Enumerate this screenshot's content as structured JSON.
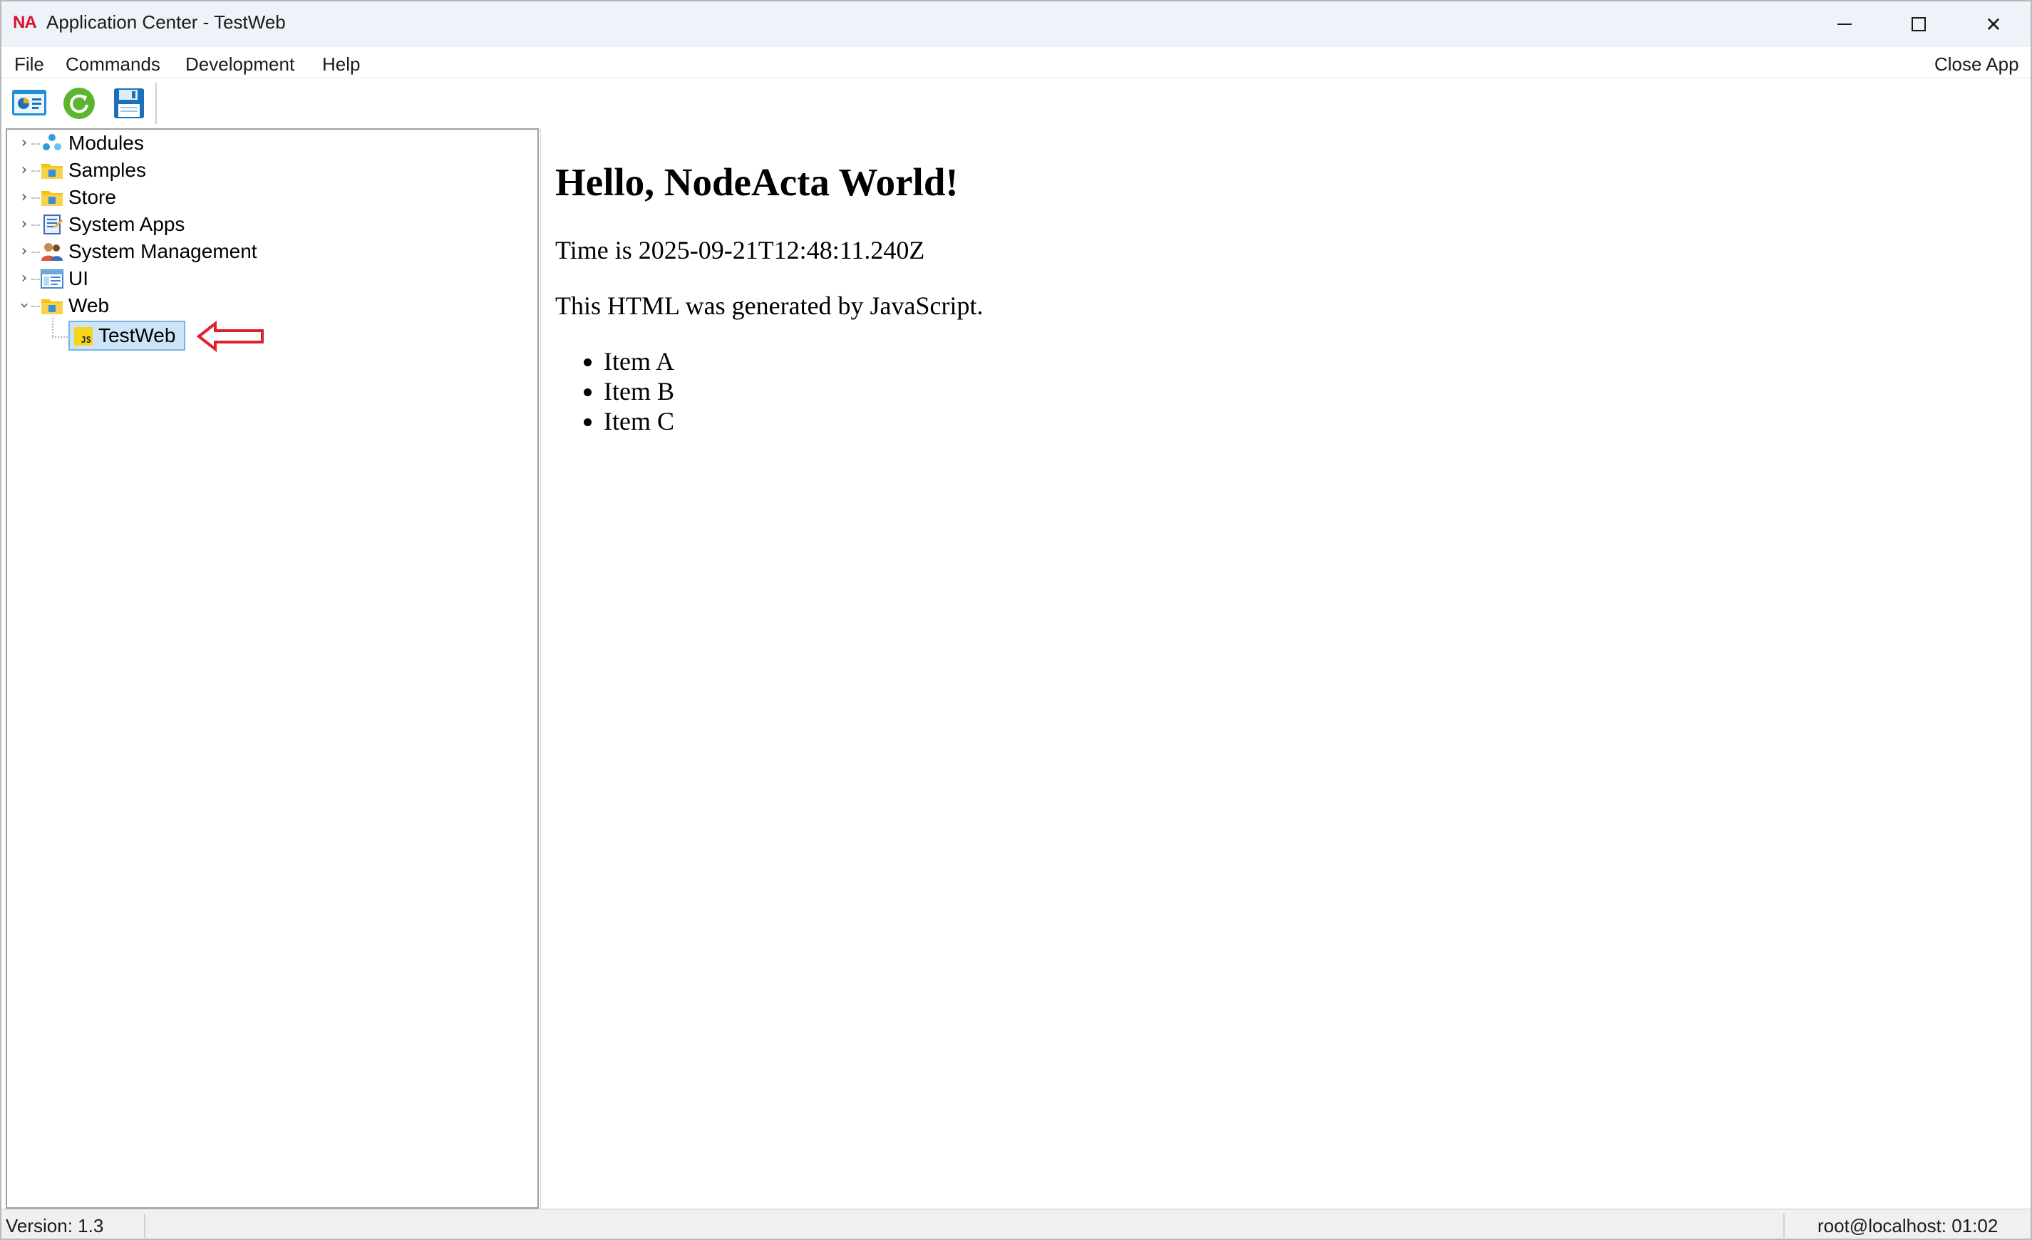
{
  "window": {
    "logo_text": "NA",
    "title": "Application Center - TestWeb",
    "minimize_icon": "minimize-icon",
    "maximize_icon": "maximize-icon",
    "close_glyph": "✕"
  },
  "menubar": {
    "file": "File",
    "commands": "Commands",
    "development": "Development",
    "help": "Help",
    "close_app": "Close App"
  },
  "toolbar": {
    "buttons": [
      {
        "icon": "apps-icon"
      },
      {
        "icon": "refresh-icon"
      },
      {
        "icon": "save-icon"
      }
    ]
  },
  "tree": {
    "items": [
      {
        "label": "Modules",
        "icon": "modules-icon",
        "expanded": false
      },
      {
        "label": "Samples",
        "icon": "folder-icon",
        "expanded": false
      },
      {
        "label": "Store",
        "icon": "folder-icon",
        "expanded": false
      },
      {
        "label": "System Apps",
        "icon": "system-apps-icon",
        "expanded": false
      },
      {
        "label": "System Management",
        "icon": "users-icon",
        "expanded": false
      },
      {
        "label": "UI",
        "icon": "ui-window-icon",
        "expanded": false
      },
      {
        "label": "Web",
        "icon": "folder-icon",
        "expanded": true
      }
    ],
    "selected_child": {
      "label": "TestWeb",
      "icon": "js-file-icon",
      "icon_text": "JS"
    }
  },
  "content": {
    "heading": "Hello, NodeActa World!",
    "time_line": "Time is 2025-09-21T12:48:11.240Z",
    "generated_line": "This HTML was generated by JavaScript.",
    "items": [
      "Item A",
      "Item B",
      "Item C"
    ]
  },
  "statusbar": {
    "version": "Version: 1.3",
    "user": "root@localhost: 01:02"
  },
  "colors": {
    "selection_bg": "#cce4f7",
    "selection_border": "#7ab3e3",
    "annotation_arrow": "#e0202a",
    "logo": "#d8102a",
    "folder": "#f5c211"
  }
}
